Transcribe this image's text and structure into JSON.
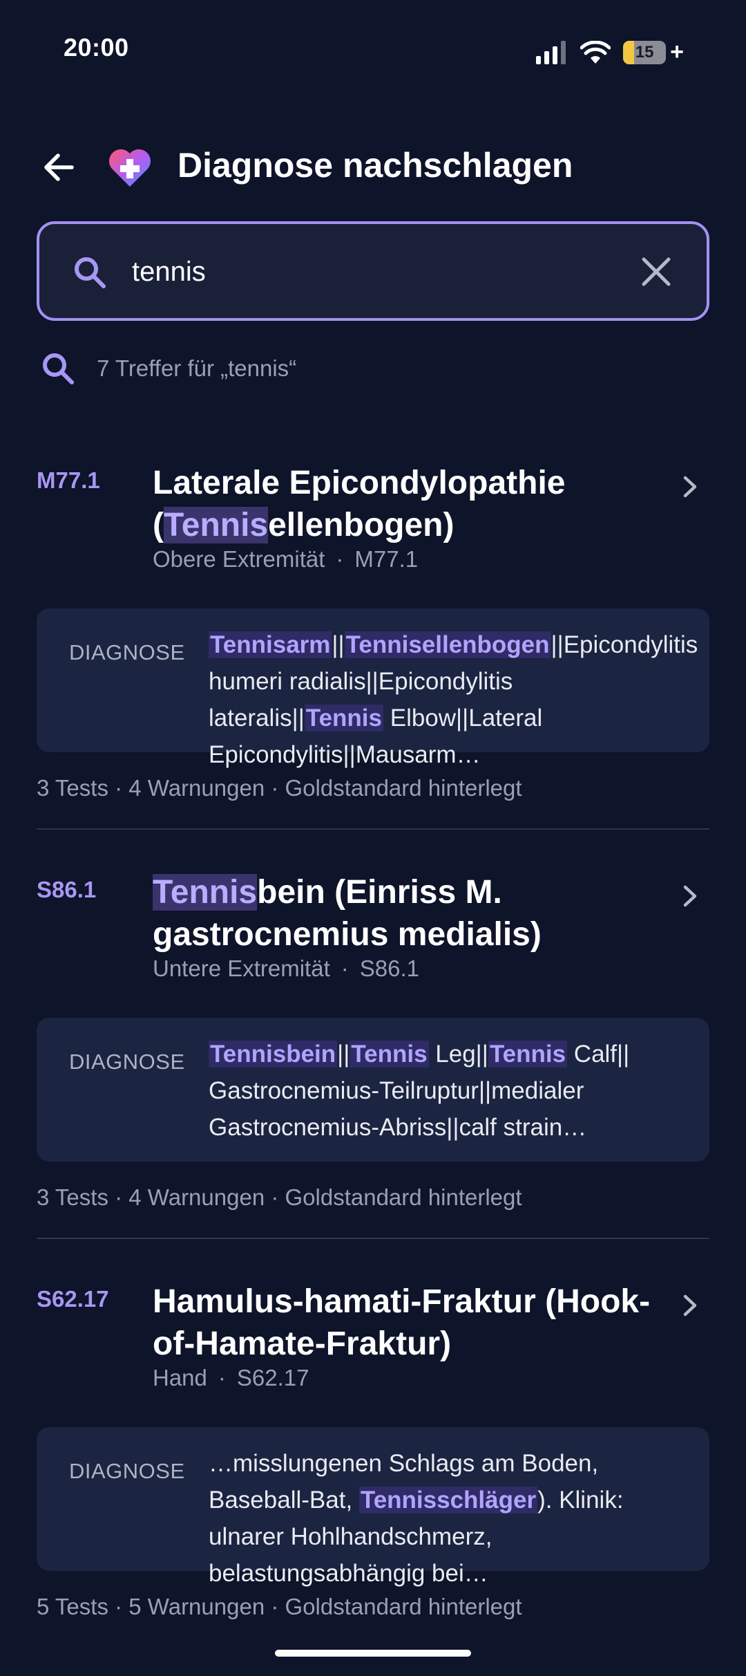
{
  "status_bar": {
    "time": "20:00",
    "battery_level": "15"
  },
  "header": {
    "title": "Diagnose nachschlagen"
  },
  "search": {
    "value": "tennis",
    "placeholder": ""
  },
  "result_count": "7 Treffer für „tennis“",
  "card_label": "DIAGNOSE",
  "results": [
    {
      "code": "M77.1",
      "title_pre": "Laterale Epicondylopathie (",
      "title_hl": "Tennis",
      "title_post": "ellenbogen)",
      "region": "Obere Extremität",
      "code_meta": "M77.1",
      "snippet": [
        {
          "t": "Tennisarm",
          "h": true
        },
        {
          "t": "||",
          "h": false
        },
        {
          "t": "Tennisellenbogen",
          "h": true
        },
        {
          "t": "||Epicondylitis humeri radialis||Epicondylitis lateralis||",
          "h": false
        },
        {
          "t": "Tennis",
          "h": true
        },
        {
          "t": " Elbow||Lateral Epicondylitis||Mausarm…",
          "h": false
        }
      ],
      "stats": "3 Tests · 4 Warnungen · Goldstandard hinterlegt"
    },
    {
      "code": "S86.1",
      "title_pre": "",
      "title_hl": "Tennis",
      "title_post": "bein (Einriss M. gastrocnemius medialis)",
      "region": "Untere Extremität",
      "code_meta": "S86.1",
      "snippet": [
        {
          "t": "Tennisbein",
          "h": true
        },
        {
          "t": "||",
          "h": false
        },
        {
          "t": "Tennis",
          "h": true
        },
        {
          "t": " Leg||",
          "h": false
        },
        {
          "t": "Tennis",
          "h": true
        },
        {
          "t": " Calf|| Gastrocnemius-Teilruptur||medialer Gastrocnemius-Abriss||calf strain…",
          "h": false
        }
      ],
      "stats": "3 Tests · 4 Warnungen · Goldstandard hinterlegt"
    },
    {
      "code": "S62.17",
      "title_pre": "Hamulus-hamati-Fraktur (Hook-of-Hamate-Fraktur)",
      "title_hl": "",
      "title_post": "",
      "region": "Hand",
      "code_meta": "S62.17",
      "snippet": [
        {
          "t": "…misslungenen Schlags am Boden, Baseball-Bat, ",
          "h": false
        },
        {
          "t": "Tennisschläger",
          "h": true
        },
        {
          "t": "). Klinik: ulnarer Hohlhandschmerz, belastungsabhängig bei…",
          "h": false
        }
      ],
      "stats": "5 Tests · 5 Warnungen · Goldstandard hinterlegt"
    }
  ],
  "colors": {
    "background": "#0e1429",
    "accent": "#a896f4",
    "card": "#1b2440",
    "highlight": "#2f2b66"
  }
}
